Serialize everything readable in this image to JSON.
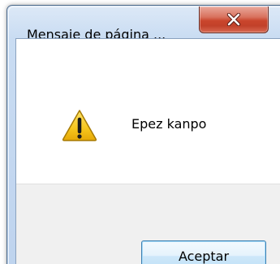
{
  "dialog": {
    "title": "Mensaje de página ...",
    "message": "Epez kanpo",
    "ok_label": "Aceptar",
    "close_icon": "close-icon",
    "message_icon": "warning-icon"
  },
  "colors": {
    "close_button": "#c9452c",
    "warning_yellow": "#f6c61d",
    "button_border": "#3c7fb1",
    "footer_bg": "#f0f0f0"
  }
}
